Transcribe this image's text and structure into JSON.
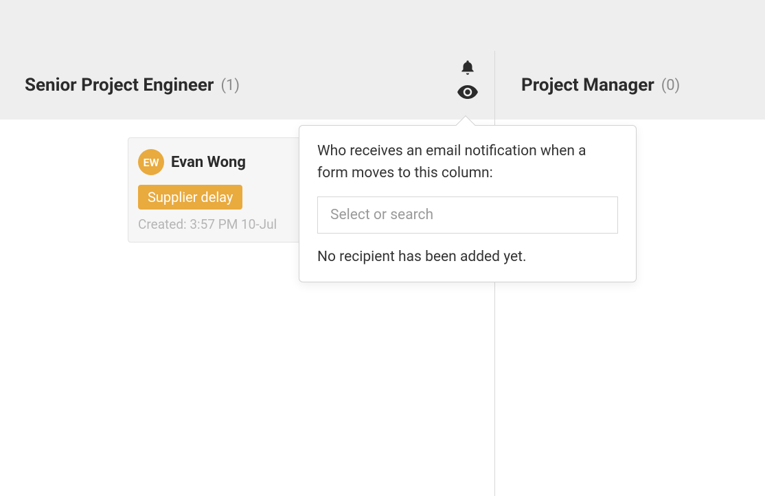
{
  "columns": {
    "left": {
      "title": "Senior Project Engineer",
      "count": "(1)"
    },
    "right": {
      "title": "Project Manager",
      "count": "(0)"
    }
  },
  "card": {
    "avatar_initials": "EW",
    "name": "Evan Wong",
    "tag": "Supplier delay",
    "created": "Created: 3:57 PM 10-Jul"
  },
  "popover": {
    "description": "Who receives an email notification when a form moves to this column:",
    "placeholder": "Select or search",
    "empty": "No recipient has been added yet."
  }
}
